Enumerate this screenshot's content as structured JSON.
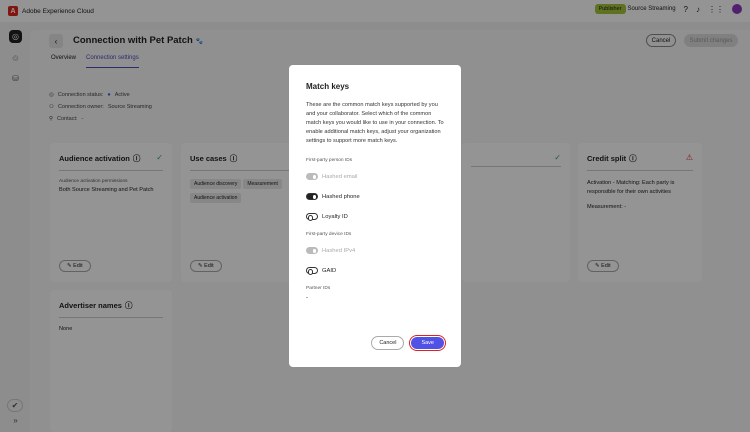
{
  "app": {
    "name": "Adobe Experience Cloud",
    "role_badge": "Publisher",
    "org": "Source Streaming"
  },
  "page": {
    "title": "Connection with Pet Patch",
    "tabs": [
      "Overview",
      "Connection settings"
    ],
    "cancel": "Cancel",
    "submit": "Submit changes",
    "status_label": "Connection status:",
    "status_value": "Active",
    "owner_label": "Connection owner:",
    "owner_value": "Source Streaming",
    "contact_label": "Contact:",
    "contact_value": "-"
  },
  "cards": {
    "audience": {
      "title": "Audience activation",
      "perm_label": "Audience activation permissions",
      "perm_value": "Both Source Streaming and Pet Patch",
      "edit": "Edit"
    },
    "usecases": {
      "title": "Use cases",
      "chips": [
        "Audience discovery",
        "Measurement",
        "Audience activation"
      ],
      "edit": "Edit"
    },
    "credit": {
      "title": "Credit split",
      "line1": "Activation - Matching: Each party is responsible for their own activities",
      "line2": "Measurement: -",
      "edit": "Edit"
    },
    "advertiser": {
      "title": "Advertiser names",
      "value": "None"
    }
  },
  "modal": {
    "title": "Match keys",
    "description": "These are the common match keys supported by you and your collaborator. Select which of the common match keys you would like to use in your connection. To enable additional match keys, adjust your organization settings to support more match keys.",
    "section1": "First-party person IDs",
    "hashed_email": "Hashed email",
    "hashed_phone": "Hashed phone",
    "loyalty_id": "Loyalty ID",
    "section2": "First-party device IDs",
    "hashed_ipv4": "Hashed IPv4",
    "gaid": "GAID",
    "section3": "Partner IDs",
    "partner_value": "-",
    "cancel": "Cancel",
    "save": "Save"
  }
}
